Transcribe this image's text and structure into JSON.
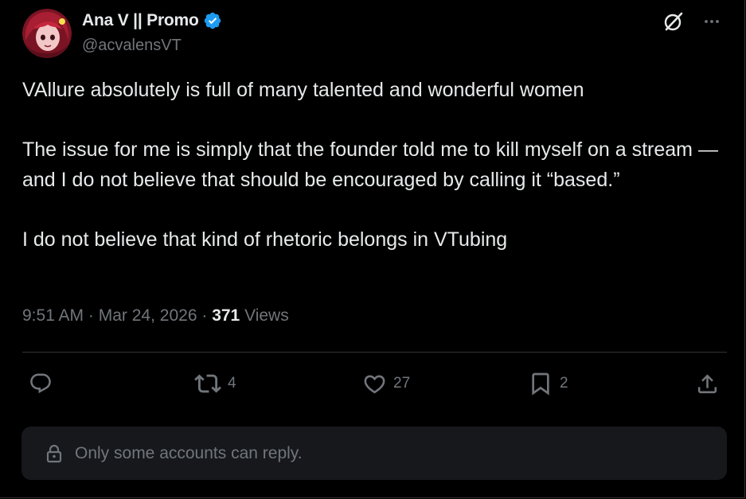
{
  "author": {
    "display_name": "Ana V || Promo",
    "handle": "@acvalensVT",
    "verified": true
  },
  "tweet": {
    "paragraphs": [
      "VAllure absolutely is full of many talented and wonderful women",
      "The issue for me is simply that the founder told me to kill myself on a stream — and I do not believe that should be encouraged by calling it “based.”",
      "I do not believe that kind of rhetoric belongs in VTubing"
    ]
  },
  "meta": {
    "time": "9:51 AM",
    "separator": "·",
    "date": "Mar 24, 2026",
    "views_count": "371",
    "views_label": "Views"
  },
  "actions": {
    "reply_count": "",
    "repost_count": "4",
    "like_count": "27",
    "bookmark_count": "2"
  },
  "reply_notice": {
    "text": "Only some accounts can reply."
  },
  "colors": {
    "background": "#000000",
    "text_primary": "#e7e9ea",
    "text_secondary": "#71767b",
    "verified_blue": "#1d9bf0",
    "divider": "#2f3336",
    "notice_bg": "#16181c"
  },
  "icons": {
    "top": [
      "grok-icon",
      "more-icon"
    ],
    "actions": [
      "reply-icon",
      "repost-icon",
      "like-icon",
      "bookmark-icon",
      "share-icon"
    ],
    "notice": "lock-icon"
  }
}
